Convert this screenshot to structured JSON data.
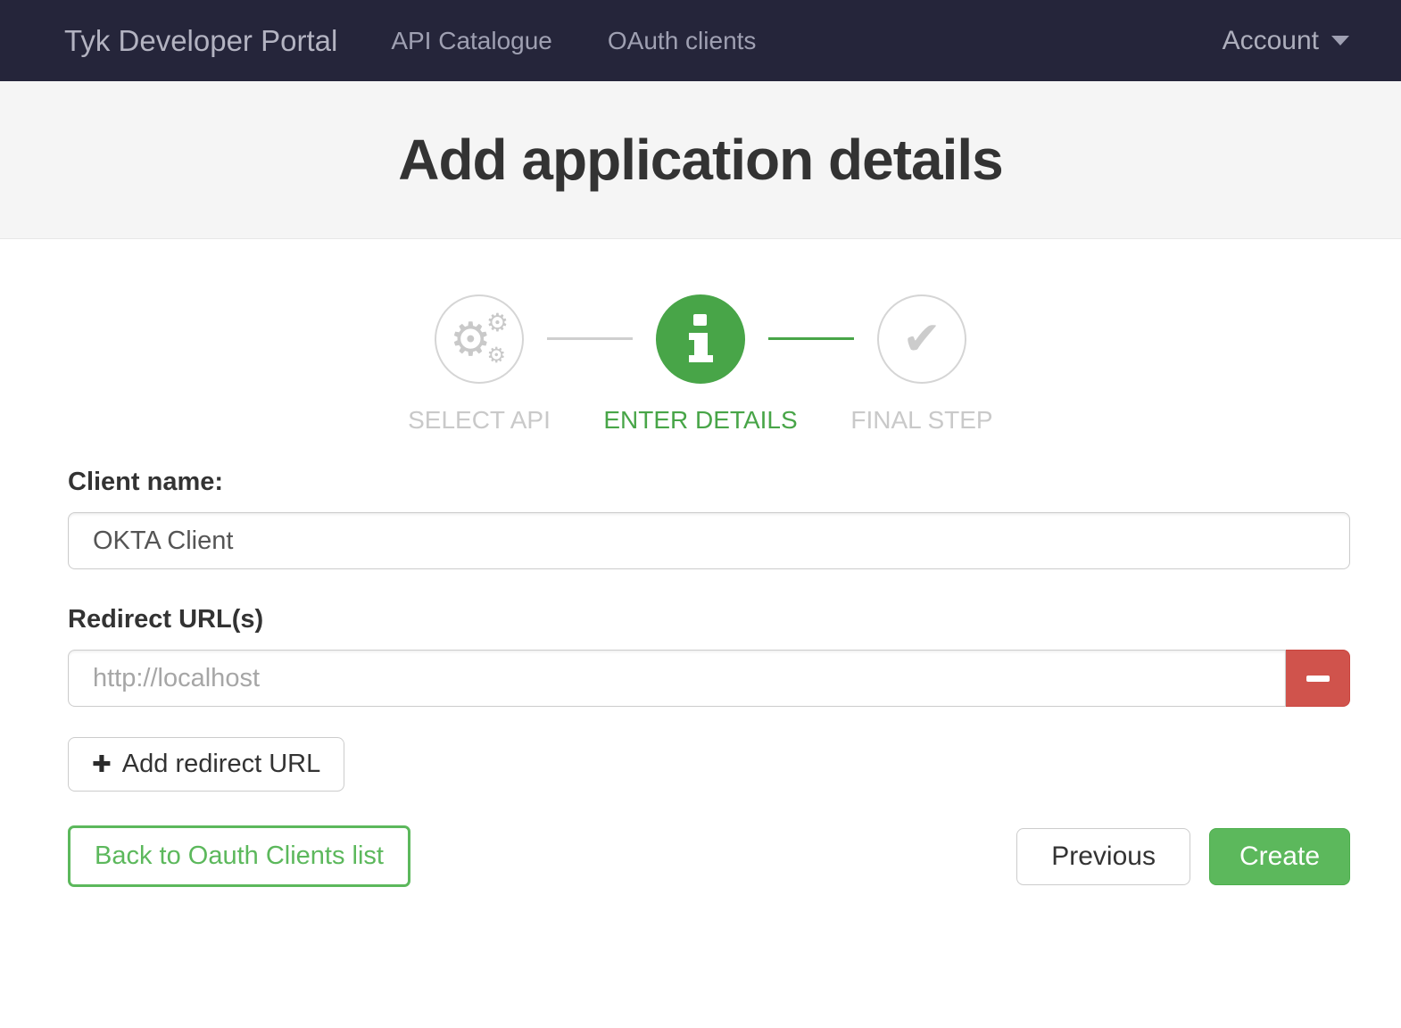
{
  "navbar": {
    "brand": "Tyk Developer Portal",
    "links": [
      {
        "label": "API Catalogue"
      },
      {
        "label": "OAuth clients"
      }
    ],
    "account_label": "Account"
  },
  "header": {
    "title": "Add application details"
  },
  "wizard": {
    "steps": [
      {
        "label": "SELECT API",
        "icon": "gears-icon",
        "state": "inactive"
      },
      {
        "label": "ENTER DETAILS",
        "icon": "info-icon",
        "state": "active"
      },
      {
        "label": "FINAL STEP",
        "icon": "check-icon",
        "state": "inactive"
      }
    ]
  },
  "form": {
    "client_name_label": "Client name:",
    "client_name_value": "OKTA Client",
    "redirect_label": "Redirect URL(s)",
    "redirect_placeholder": "http://localhost",
    "add_redirect_label": "Add redirect URL",
    "back_button_label": "Back to Oauth Clients list",
    "previous_label": "Previous",
    "create_label": "Create"
  },
  "colors": {
    "navbar_bg": "#25253a",
    "step_green": "#48a548",
    "button_green": "#5cb85c",
    "danger_red": "#d0534c",
    "header_bg": "#f5f5f5"
  }
}
